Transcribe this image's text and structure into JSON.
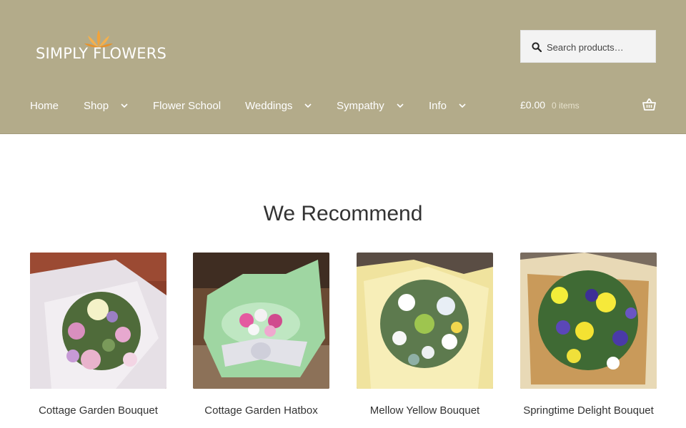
{
  "brand": {
    "name": "SIMPLY FLOWERS"
  },
  "search": {
    "placeholder": "Search products…"
  },
  "nav": {
    "items": [
      {
        "label": "Home",
        "has_dropdown": false
      },
      {
        "label": "Shop",
        "has_dropdown": true
      },
      {
        "label": "Flower School",
        "has_dropdown": false
      },
      {
        "label": "Weddings",
        "has_dropdown": true
      },
      {
        "label": "Sympathy",
        "has_dropdown": true
      },
      {
        "label": "Info",
        "has_dropdown": true
      }
    ]
  },
  "cart": {
    "amount": "£0.00",
    "count": "0 items"
  },
  "main": {
    "heading": "We Recommend",
    "products": [
      {
        "name": "Cottage Garden Bouquet"
      },
      {
        "name": "Cottage Garden Hatbox"
      },
      {
        "name": "Mellow Yellow Bouquet"
      },
      {
        "name": "Springtime Delight Bouquet"
      }
    ]
  },
  "colors": {
    "header_bg": "#b3ab8a",
    "logo_accent": "#f2a33a",
    "text": "#333333"
  }
}
